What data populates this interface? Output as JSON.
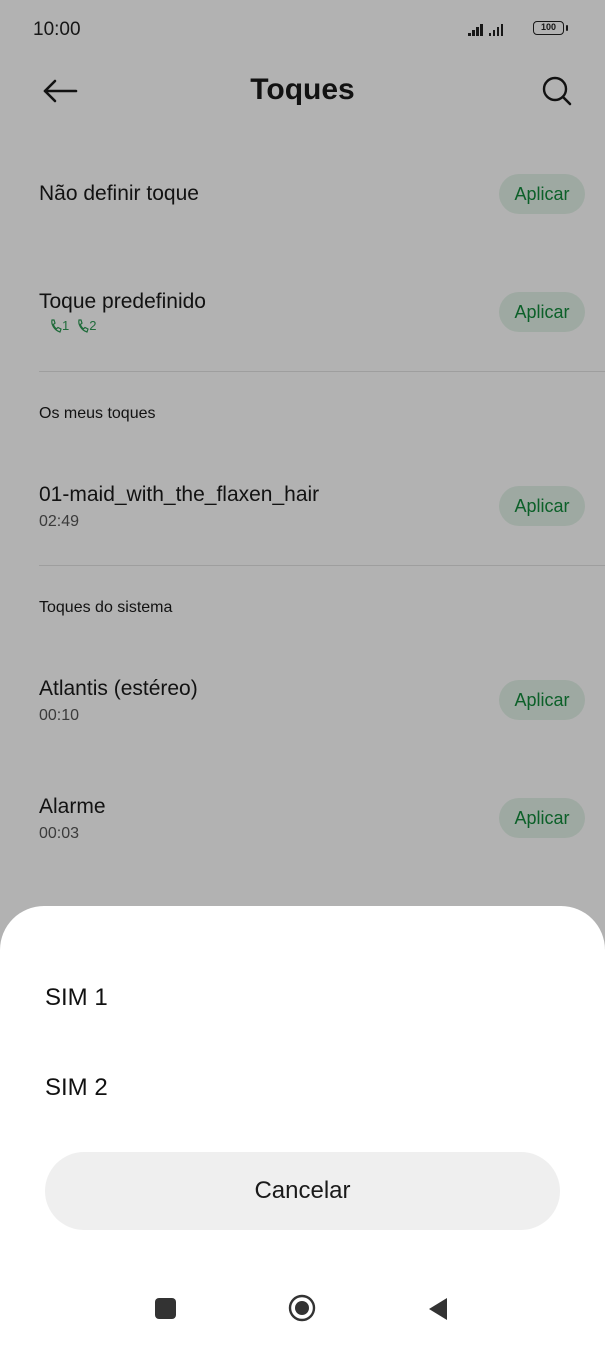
{
  "status_bar": {
    "time": "10:00",
    "battery": "100"
  },
  "header": {
    "title": "Toques",
    "back_icon": "arrow-left-icon",
    "search_icon": "search-icon"
  },
  "list": {
    "rows": [
      {
        "title": "Não definir toque",
        "apply": "Aplicar"
      },
      {
        "title": "Toque predefinido",
        "sim_tags": [
          "1",
          "2"
        ],
        "apply": "Aplicar"
      }
    ],
    "sections": [
      {
        "label": "Os meus toques",
        "items": [
          {
            "title": "01-maid_with_the_flaxen_hair",
            "duration": "02:49",
            "apply": "Aplicar"
          }
        ]
      },
      {
        "label": "Toques do sistema",
        "items": [
          {
            "title": "Atlantis (estéreo)",
            "duration": "00:10",
            "apply": "Aplicar"
          },
          {
            "title": "Alarme",
            "duration": "00:03",
            "apply": "Aplicar"
          }
        ]
      }
    ]
  },
  "sheet": {
    "options": [
      "SIM 1",
      "SIM 2"
    ],
    "cancel": "Cancelar"
  },
  "colors": {
    "accent": "#128a3c",
    "accent_bg": "#e3f3e8",
    "dim": "rgba(0,0,0,0.30)"
  },
  "nav": {
    "recents_icon": "square-icon",
    "home_icon": "circle-icon",
    "back_icon": "triangle-back-icon"
  }
}
